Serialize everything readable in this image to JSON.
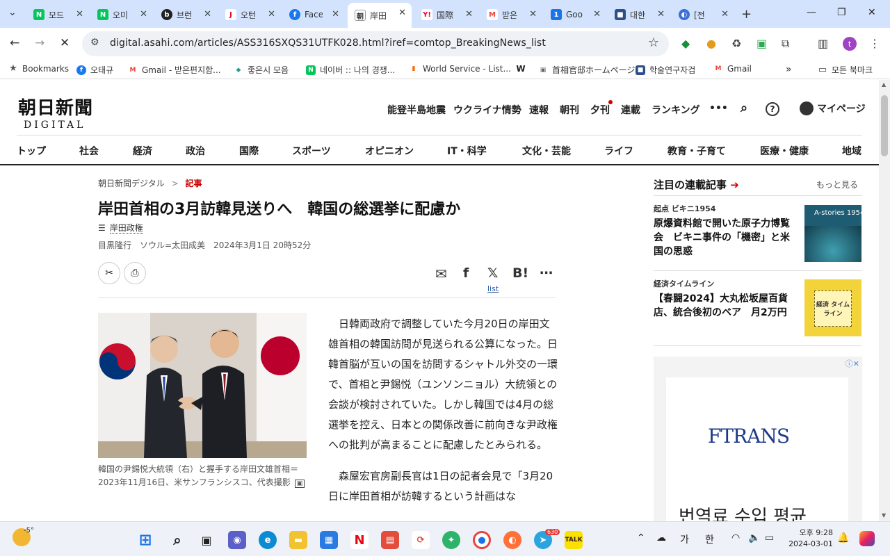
{
  "browser": {
    "tabs": [
      {
        "title": "모드",
        "icon": "N",
        "color": "#03c75a"
      },
      {
        "title": "오미",
        "icon": "N",
        "color": "#03c75a"
      },
      {
        "title": "브런",
        "icon": "b",
        "color": "#222222"
      },
      {
        "title": "오턴",
        "icon": "J",
        "color": "#e6002d"
      },
      {
        "title": "Face",
        "icon": "f",
        "color": "#1877f2"
      },
      {
        "title": "岸田",
        "icon": "朝",
        "color": "#333333",
        "active": true
      },
      {
        "title": "国際",
        "icon": "Y!",
        "color": "#ff0033"
      },
      {
        "title": "받은",
        "icon": "M",
        "color": "#ea4335"
      },
      {
        "title": "Goo",
        "icon": "1",
        "color": "#1a73e8"
      },
      {
        "title": "대한",
        "icon": "■",
        "color": "#2d4f8a"
      },
      {
        "title": "[전",
        "icon": "◐",
        "color": "#3b6fd9"
      }
    ],
    "url": "digital.asahi.com/articles/ASS316SXQS31UTFK028.html?iref=comtop_BreakingNews_list",
    "profile_initial": "t",
    "bookmarks": [
      {
        "label": "Bookmarks",
        "icon": "★",
        "color": "#555555"
      },
      {
        "label": "오태규",
        "icon": "f",
        "color": "#1877f2"
      },
      {
        "label": "Gmail - 받은편지함...",
        "icon": "M",
        "color": "#ea4335"
      },
      {
        "label": "좋은시 모음",
        "icon": "◆",
        "color": "#2a9d8f"
      },
      {
        "label": "네이버 :: 나의 경쟁...",
        "icon": "N",
        "color": "#03c75a"
      },
      {
        "label": "World Service - List...",
        "icon": "▮",
        "color": "#ff6600"
      },
      {
        "label": "",
        "icon": "W",
        "color": "#222222"
      },
      {
        "label": "首相官邸ホームページ",
        "icon": "▣",
        "color": "#666666"
      },
      {
        "label": "학술연구자검",
        "icon": "■",
        "color": "#2d4f8a"
      },
      {
        "label": "Gmail",
        "icon": "M",
        "color": "#ea4335"
      }
    ],
    "bookmarks_more": "»",
    "all_bookmarks": "모든 북마크"
  },
  "site": {
    "logo_jp": "朝日新聞",
    "logo_sub": "DIGITAL",
    "topnav": [
      "能登半島地震",
      "ウクライナ情勢",
      "速報",
      "朝刊",
      "夕刊",
      "連載",
      "ランキング",
      "•••"
    ],
    "mypage": "マイページ",
    "categories": [
      "トップ",
      "社会",
      "経済",
      "政治",
      "国際",
      "スポーツ",
      "オピニオン",
      "IT・科学",
      "文化・芸能",
      "ライフ",
      "教育・子育て",
      "医療・健康",
      "地域"
    ]
  },
  "article": {
    "breadcrumb_home": "朝日新聞デジタル",
    "breadcrumb_sep": ">",
    "breadcrumb_current": "記事",
    "headline": "岸田首相の3月訪韓見送りへ　韓国の総選挙に配慮か",
    "tag": "岸田政権",
    "byline": "目黒隆行　ソウル=太田成美　2024年3月1日 20時52分",
    "share_list_label": "list",
    "caption": "韓国の尹錫悦大統領（右）と握手する岸田文雄首相＝2023年11月16日、米サンフランシスコ、代表撮影",
    "paragraphs": [
      "日韓両政府で調整していた今月20日の岸田文雄首相の韓国訪問が見送られる公算になった。日韓首脳が互いの国を訪問するシャトル外交の一環で、首相と尹錫悦（ユンソンニョル）大統領との会談が検討されていた。しかし韓国では4月の総選挙を控え、日本との関係改善に前向きな尹政権への批判が高まることに配慮したとみられる。",
      "森屋宏官房副長官は1日の記者会見で「3月20日に岸田首相が訪韓するという計画はな"
    ]
  },
  "sidebar": {
    "heading": "注目の連載記事",
    "more": "もっと見る",
    "items": [
      {
        "kicker": "起点 ビキニ1954",
        "title": "原爆資料館で開いた原子力博覧会　ビキニ事件の「機密」と米国の思惑",
        "thumb_text": "A-stories 1954"
      },
      {
        "kicker": "経済タイムライン",
        "title": "【春闘2024】大丸松坂屋百貨店、統合後初のベア　月2万円",
        "thumb_text": "経済 タイムライン"
      }
    ],
    "ad_brand": "FTRANS",
    "ad_text": "번역료 수입 평균"
  },
  "taskbar": {
    "weather": "-5°",
    "time": "오후 9:28",
    "date": "2024-03-01",
    "ime1": "가",
    "ime2": "한",
    "badge": "630"
  }
}
